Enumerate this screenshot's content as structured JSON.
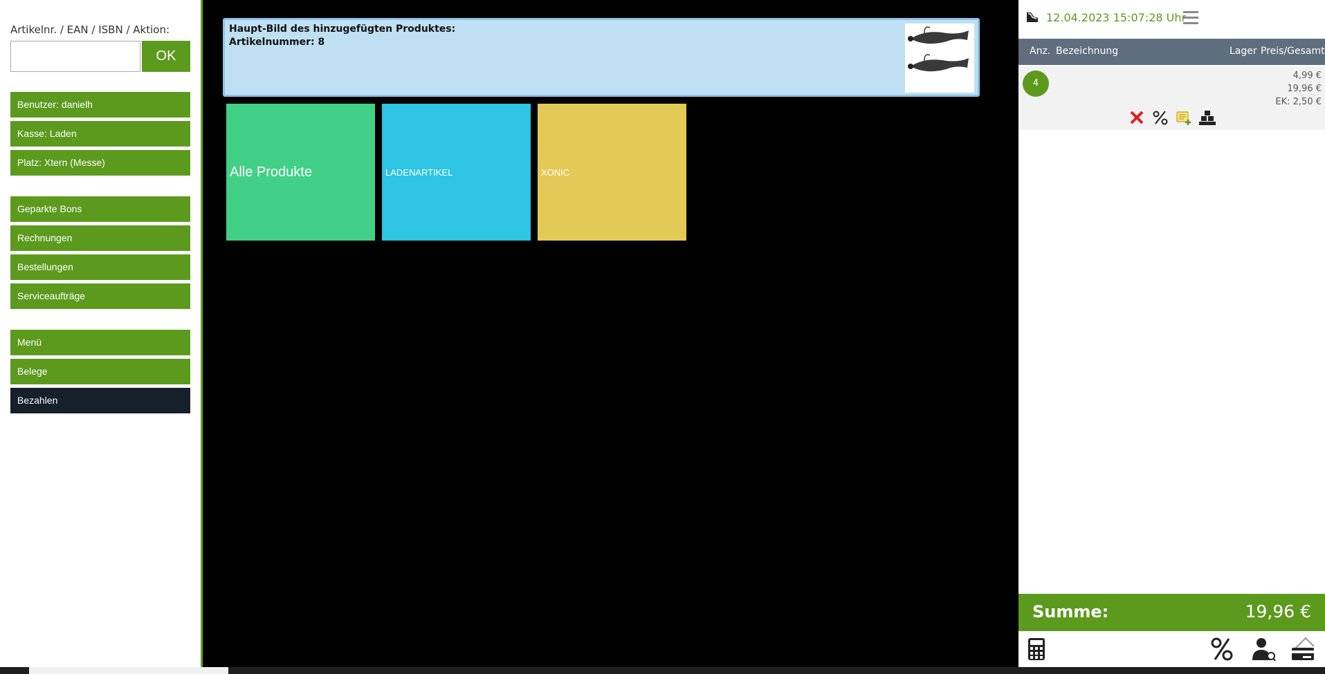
{
  "search": {
    "label": "Artikelnr. / EAN / ISBN / Aktion:",
    "value": "",
    "ok_label": "OK"
  },
  "sidebar": {
    "info": [
      "Benutzer: danielh",
      "Kasse: Laden",
      "Platz: Xtern (Messe)"
    ],
    "actions": [
      "Geparkte Bons",
      "Rechnungen",
      "Bestellungen",
      "Serviceaufträge"
    ],
    "menu": [
      "Menü",
      "Belege",
      "Bezahlen"
    ]
  },
  "banner": {
    "title": "Haupt-Bild des hinzugefügten Produktes:",
    "article": "Artikelnummer: 8"
  },
  "tiles": [
    {
      "label": "Alle Produkte",
      "color": "#42d087"
    },
    {
      "label": "LADENARTIKEL",
      "color": "#2ec4e3"
    },
    {
      "label": "XONIC",
      "color": "#e3c955"
    }
  ],
  "cart": {
    "datetime": "12.04.2023 15:07:28 Uhr",
    "columns": [
      "Anz.",
      "Bezeichnung",
      "Lager",
      "Preis/Gesamt"
    ],
    "item": {
      "qty": "4",
      "unit_price": "4,99 €",
      "total": "19,96 €",
      "ek": "EK: 2,50 €"
    },
    "sum_label": "Summe:",
    "sum_value": "19,96 €"
  },
  "colors": {
    "accent": "#5c9a1e",
    "dark_button": "#15202b",
    "banner": "#bfe0f3",
    "header": "#5f6e7e"
  }
}
